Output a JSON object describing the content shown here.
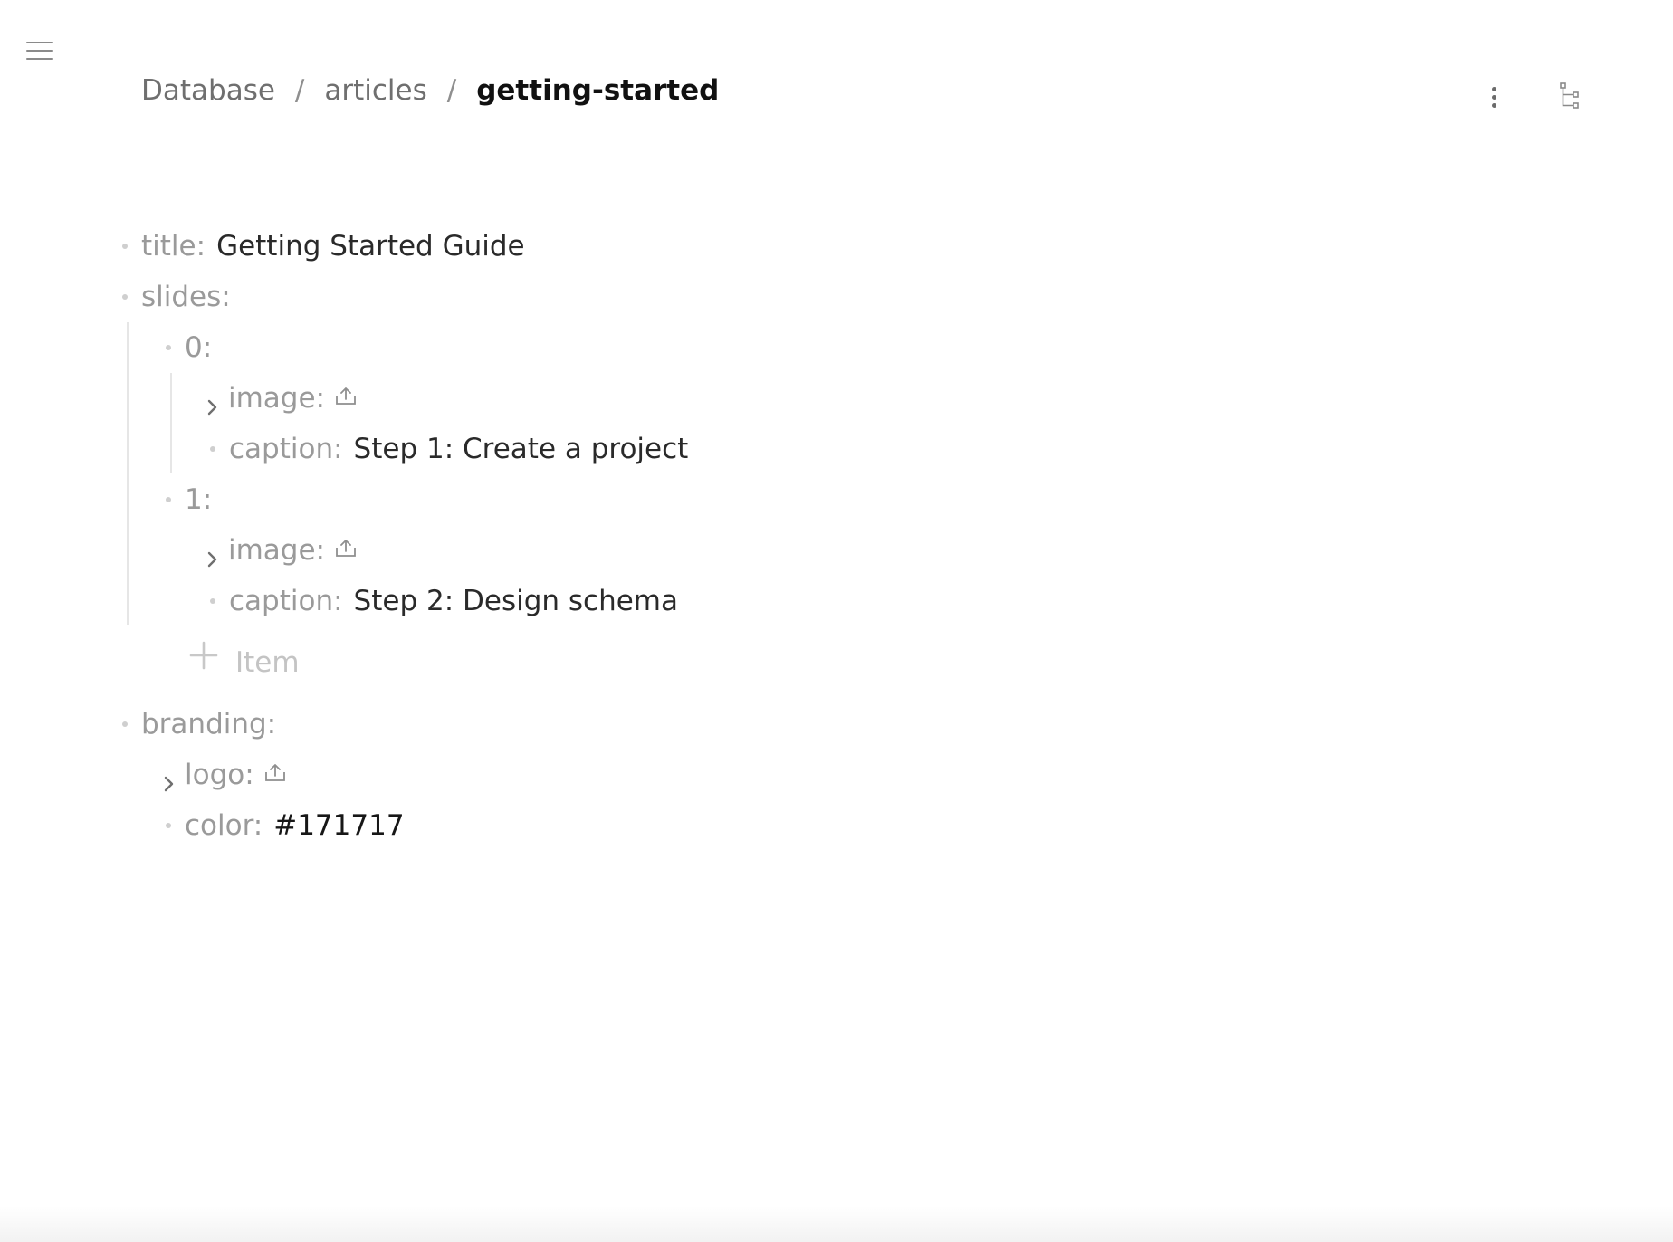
{
  "breadcrumb": {
    "items": [
      "Database",
      "articles"
    ],
    "separator": "/",
    "current": "getting-started"
  },
  "document": {
    "title_key": "title:",
    "title_value": "Getting Started Guide",
    "slides_key": "slides:",
    "slides": [
      {
        "index_key": "0:",
        "image_key": "image:",
        "caption_key": "caption:",
        "caption_value": "Step 1: Create a project"
      },
      {
        "index_key": "1:",
        "image_key": "image:",
        "caption_key": "caption:",
        "caption_value": "Step 2: Design schema"
      }
    ],
    "add_item_label": "Item",
    "branding_key": "branding:",
    "branding": {
      "logo_key": "logo:",
      "color_key": "color:",
      "color_value": "#171717"
    }
  },
  "icons": {
    "menu": "hamburger-menu-icon",
    "more": "vertical-dots-icon",
    "tree": "tree-structure-icon",
    "upload": "upload-icon",
    "chevron": "chevron-right-icon",
    "plus": "plus-icon"
  }
}
